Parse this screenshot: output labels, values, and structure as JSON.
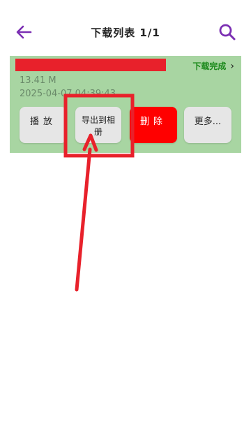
{
  "header": {
    "title": "下载列表 1/1",
    "back_icon": "arrow-left-icon",
    "search_icon": "search-icon"
  },
  "item": {
    "status_label": "下载完成",
    "size": "13.41 M",
    "date": "2025-04-07 04:39:43",
    "buttons": {
      "play": "播放",
      "export": "导出到相册",
      "delete": "删除",
      "more": "更多..."
    }
  },
  "colors": {
    "accent": "#7b2fb3",
    "card_bg": "#a8d5a2",
    "status_green": "#1c8a1c",
    "delete_red": "#ff0000",
    "annotation_red": "#e8212b"
  }
}
